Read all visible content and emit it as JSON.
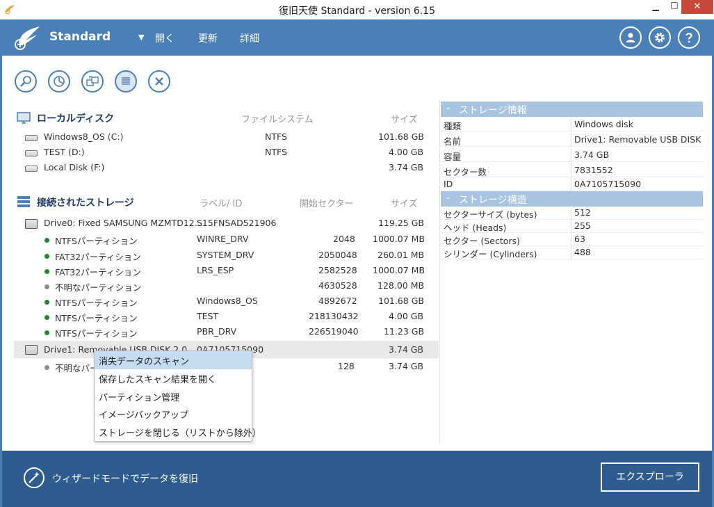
{
  "window": {
    "title": "復旧天使 Standard - version 6.15",
    "min_glyph": "▁",
    "max_glyph": "□",
    "close_glyph": "✕"
  },
  "header": {
    "brand": "Standard",
    "caret": "▼",
    "menu_open": "開く",
    "menu_refresh": "更新",
    "menu_detail": "詳細",
    "accent": "#4a7fb7"
  },
  "toolbar": {
    "buttons": [
      "search-icon",
      "pie-chart-icon",
      "copy-icon",
      "list-icon",
      "close-icon"
    ]
  },
  "local": {
    "title": "ローカルディスク",
    "col_fs": "ファイルシステム",
    "col_size": "サイズ",
    "disks": [
      {
        "name": "Windows8_OS (C:)",
        "fs": "NTFS",
        "size": "101.68 GB"
      },
      {
        "name": "TEST (D:)",
        "fs": "NTFS",
        "size": "4.00 GB"
      },
      {
        "name": "Local Disk (F:)",
        "fs": "",
        "size": "3.74 GB"
      }
    ]
  },
  "storage": {
    "title": "接続されたストレージ",
    "col_label": "ラベル/ ID",
    "col_start": "開始セクター",
    "col_size": "サイズ",
    "drive0": {
      "name": "Drive0: Fixed SAMSUNG MZMTD12...",
      "id": "S15FNSAD521906",
      "size": "119.25 GB"
    },
    "drive0_parts": [
      {
        "name": "NTFSパーティション",
        "label": "WINRE_DRV",
        "start": "2048",
        "size": "1000.07 MB",
        "status": "green"
      },
      {
        "name": "FAT32パーティション",
        "label": "SYSTEM_DRV",
        "start": "2050048",
        "size": "260.01 MB",
        "status": "green"
      },
      {
        "name": "FAT32パーティション",
        "label": "LRS_ESP",
        "start": "2582528",
        "size": "1000.07 MB",
        "status": "green"
      },
      {
        "name": "不明なパーティション",
        "label": "",
        "start": "4630528",
        "size": "128.00 MB",
        "status": "gray"
      },
      {
        "name": "NTFSパーティション",
        "label": "Windows8_OS",
        "start": "4892672",
        "size": "101.68 GB",
        "status": "green"
      },
      {
        "name": "NTFSパーティション",
        "label": "TEST",
        "start": "218130432",
        "size": "4.00 GB",
        "status": "green"
      },
      {
        "name": "NTFSパーティション",
        "label": "PBR_DRV",
        "start": "226519040",
        "size": "11.23 GB",
        "status": "green"
      }
    ],
    "drive1": {
      "name": "Drive1: Removable USB DISK 2.0",
      "id": "0A7105715090",
      "size": "3.74 GB"
    },
    "drive1_parts": [
      {
        "name": "不明なパーティション",
        "label": "",
        "start": "128",
        "size": "3.74 GB",
        "status": "gray"
      }
    ]
  },
  "context_menu": {
    "items": [
      "消失データのスキャン",
      "保存したスキャン結果を開く",
      "パーティション管理",
      "イメージバックアップ",
      "ストレージを閉じる（リストから除外）"
    ]
  },
  "info": {
    "storage_info_title": "ストレージ情報",
    "storage_info": [
      {
        "k": "種類",
        "v": "Windows disk"
      },
      {
        "k": "名前",
        "v": "Drive1: Removable USB DISK 2.0"
      },
      {
        "k": "容量",
        "v": "3.74 GB"
      },
      {
        "k": "セクター数",
        "v": "7831552"
      },
      {
        "k": "ID",
        "v": "0A7105715090"
      }
    ],
    "structure_title": "ストレージ構造",
    "structure": [
      {
        "k": "セクターサイズ (bytes)",
        "v": "512"
      },
      {
        "k": "ヘッド (Heads)",
        "v": "255"
      },
      {
        "k": "セクター (Sectors)",
        "v": "63"
      },
      {
        "k": "シリンダー (Cylinders)",
        "v": "488"
      }
    ],
    "collapse_glyph": "-"
  },
  "footer": {
    "wizard": "ウィザードモードでデータを復旧",
    "explorer": "エクスプローラ"
  }
}
